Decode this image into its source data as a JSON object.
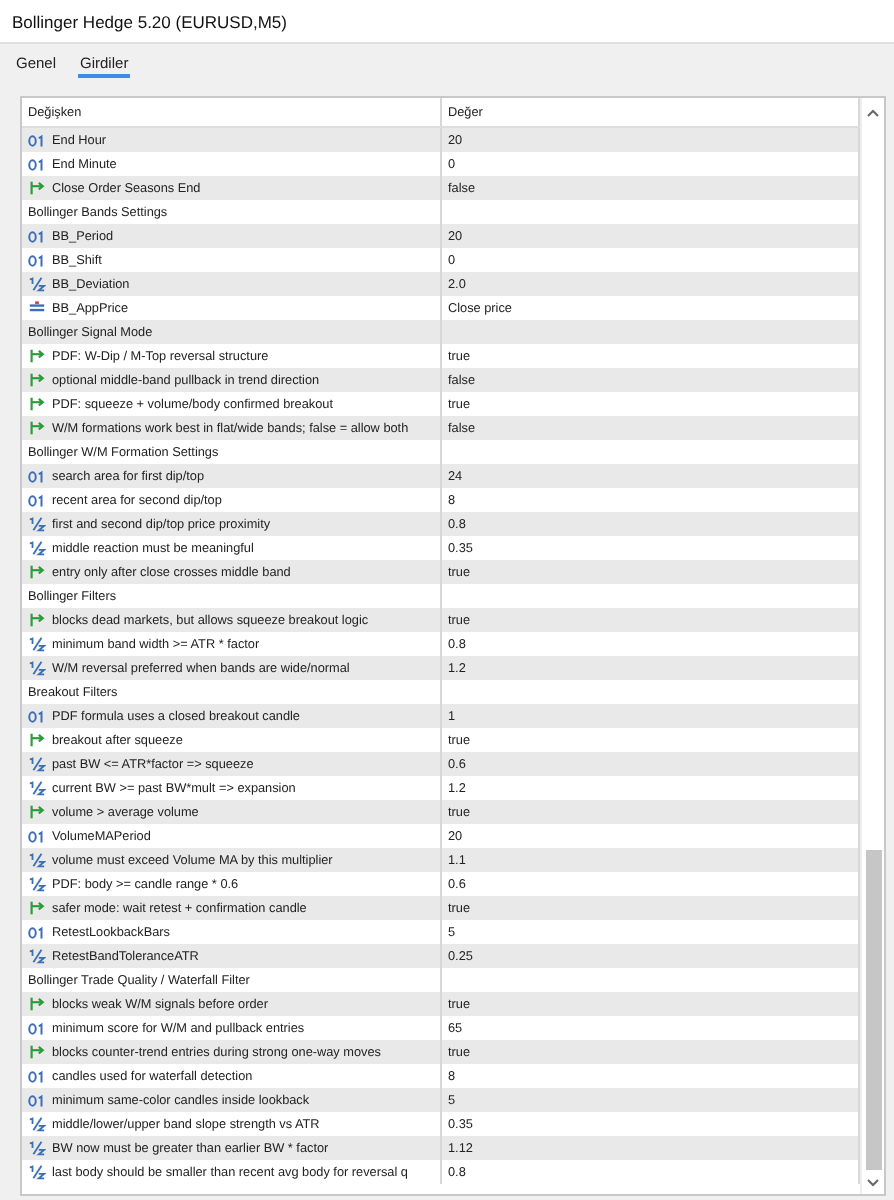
{
  "window": {
    "title": "Bollinger Hedge 5.20 (EURUSD,M5)"
  },
  "tabs": [
    {
      "label": "Genel",
      "selected": false
    },
    {
      "label": "Girdiler",
      "selected": true
    }
  ],
  "table": {
    "columns": [
      "Değişken",
      "Değer"
    ],
    "rows": [
      {
        "kind": "int",
        "name": "End Hour",
        "value": "20"
      },
      {
        "kind": "int",
        "name": "End Minute",
        "value": "0"
      },
      {
        "kind": "bool",
        "name": "Close Order Seasons End",
        "value": "false"
      },
      {
        "kind": "group",
        "name": "Bollinger Bands Settings"
      },
      {
        "kind": "int",
        "name": "BB_Period",
        "value": "20"
      },
      {
        "kind": "int",
        "name": "BB_Shift",
        "value": "0"
      },
      {
        "kind": "double",
        "name": "BB_Deviation",
        "value": "2.0"
      },
      {
        "kind": "enum",
        "name": "BB_AppPrice",
        "value": "Close price"
      },
      {
        "kind": "group",
        "name": "Bollinger Signal Mode"
      },
      {
        "kind": "bool",
        "name": "PDF: W-Dip / M-Top reversal structure",
        "value": "true"
      },
      {
        "kind": "bool",
        "name": "optional middle-band pullback in trend direction",
        "value": "false"
      },
      {
        "kind": "bool",
        "name": "PDF: squeeze + volume/body confirmed breakout",
        "value": "true"
      },
      {
        "kind": "bool",
        "name": "W/M formations work best in flat/wide bands; false = allow both",
        "value": "false"
      },
      {
        "kind": "group",
        "name": "Bollinger W/M Formation Settings"
      },
      {
        "kind": "int",
        "name": "search area for first dip/top",
        "value": "24"
      },
      {
        "kind": "int",
        "name": "recent area for second dip/top",
        "value": "8"
      },
      {
        "kind": "double",
        "name": "first and second dip/top price proximity",
        "value": "0.8"
      },
      {
        "kind": "double",
        "name": "middle reaction must be meaningful",
        "value": "0.35"
      },
      {
        "kind": "bool",
        "name": "entry only after close crosses middle band",
        "value": "true"
      },
      {
        "kind": "group",
        "name": "Bollinger Filters"
      },
      {
        "kind": "bool",
        "name": "blocks dead markets, but allows squeeze breakout logic",
        "value": "true"
      },
      {
        "kind": "double",
        "name": "minimum band width >= ATR * factor",
        "value": "0.8"
      },
      {
        "kind": "double",
        "name": "W/M reversal preferred when bands are wide/normal",
        "value": "1.2"
      },
      {
        "kind": "group",
        "name": "Breakout Filters"
      },
      {
        "kind": "int",
        "name": "PDF formula uses a closed breakout candle",
        "value": "1"
      },
      {
        "kind": "bool",
        "name": "breakout after squeeze",
        "value": "true"
      },
      {
        "kind": "double",
        "name": "past BW <= ATR*factor => squeeze",
        "value": "0.6"
      },
      {
        "kind": "double",
        "name": "current BW >= past BW*mult => expansion",
        "value": "1.2"
      },
      {
        "kind": "bool",
        "name": "volume > average volume",
        "value": "true"
      },
      {
        "kind": "int",
        "name": "VolumeMAPeriod",
        "value": "20"
      },
      {
        "kind": "double",
        "name": "volume must exceed Volume MA by this multiplier",
        "value": "1.1"
      },
      {
        "kind": "double",
        "name": "PDF: body >= candle range * 0.6",
        "value": "0.6"
      },
      {
        "kind": "bool",
        "name": "safer mode: wait retest + confirmation candle",
        "value": "true"
      },
      {
        "kind": "int",
        "name": "RetestLookbackBars",
        "value": "5"
      },
      {
        "kind": "double",
        "name": "RetestBandToleranceATR",
        "value": "0.25"
      },
      {
        "kind": "group",
        "name": "Bollinger Trade Quality / Waterfall Filter"
      },
      {
        "kind": "bool",
        "name": "blocks weak W/M signals before order",
        "value": "true"
      },
      {
        "kind": "int",
        "name": "minimum score for W/M and pullback entries",
        "value": "65"
      },
      {
        "kind": "bool",
        "name": "blocks counter-trend entries during strong one-way moves",
        "value": "true"
      },
      {
        "kind": "int",
        "name": "candles used for waterfall detection",
        "value": "8"
      },
      {
        "kind": "int",
        "name": "minimum same-color candles inside lookback",
        "value": "5"
      },
      {
        "kind": "double",
        "name": "middle/lower/upper band slope strength vs ATR",
        "value": "0.35"
      },
      {
        "kind": "double",
        "name": "BW now must be greater than earlier BW * factor",
        "value": "1.12"
      },
      {
        "kind": "double",
        "name": "last body should be smaller than recent avg body for reversal q",
        "value": "0.8"
      }
    ]
  }
}
